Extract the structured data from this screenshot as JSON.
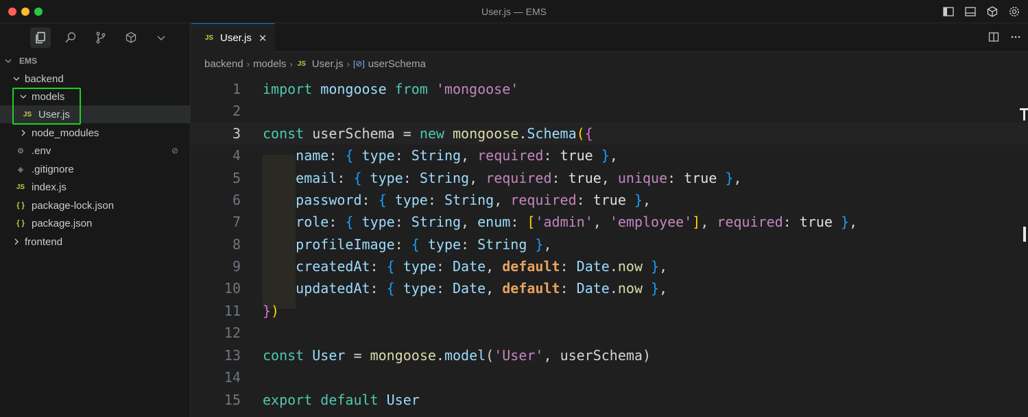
{
  "window": {
    "title": "User.js — EMS"
  },
  "sidebar": {
    "section_title": "EMS",
    "tree": [
      {
        "label": "backend",
        "kind": "folder",
        "open": true,
        "depth": 1
      },
      {
        "label": "models",
        "kind": "folder",
        "open": true,
        "depth": 2
      },
      {
        "label": "User.js",
        "kind": "js",
        "depth": 3,
        "selected": true
      },
      {
        "label": "node_modules",
        "kind": "folder",
        "open": false,
        "depth": 2
      },
      {
        "label": ".env",
        "kind": "env",
        "depth": 2,
        "badge": "⊘"
      },
      {
        "label": ".gitignore",
        "kind": "git",
        "depth": 2
      },
      {
        "label": "index.js",
        "kind": "js",
        "depth": 2
      },
      {
        "label": "package-lock.json",
        "kind": "json",
        "depth": 2
      },
      {
        "label": "package.json",
        "kind": "json",
        "depth": 2
      },
      {
        "label": "frontend",
        "kind": "folder",
        "open": false,
        "depth": 1
      }
    ],
    "js_icon_text": "JS",
    "json_icon_text": "{ }"
  },
  "editor": {
    "tab": {
      "icon_text": "JS",
      "label": "User.js",
      "close": "✕"
    },
    "breadcrumb": [
      "backend",
      "models",
      "User.js",
      "userSchema"
    ],
    "breadcrumb_js_icon": "JS",
    "current_line": 3,
    "line_numbers": [
      "1",
      "2",
      "3",
      "4",
      "5",
      "6",
      "7",
      "8",
      "9",
      "10",
      "11",
      "12",
      "13",
      "14",
      "15"
    ]
  },
  "code": {
    "line1": {
      "a": "import",
      "b": "mongoose",
      "c": "from",
      "d": "'mongoose'"
    },
    "line3": {
      "a": "const",
      "b": "userSchema",
      "c": "=",
      "d": "new",
      "e": "mongoose",
      "f": ".",
      "g": "Schema",
      "h": "(",
      "i": "{"
    },
    "line4": {
      "a": "name",
      "b": "type",
      "c": "String",
      "d": "required",
      "e": "true"
    },
    "line5": {
      "a": "email",
      "b": "type",
      "c": "String",
      "d": "required",
      "e": "true",
      "f": "unique",
      "g": "true"
    },
    "line6": {
      "a": "password",
      "b": "type",
      "c": "String",
      "d": "required",
      "e": "true"
    },
    "line7": {
      "a": "role",
      "b": "type",
      "c": "String",
      "d": "enum",
      "e": "'admin'",
      "f": "'employee'",
      "g": "required",
      "h": "true"
    },
    "line8": {
      "a": "profileImage",
      "b": "type",
      "c": "String"
    },
    "line9": {
      "a": "createdAt",
      "b": "type",
      "c": "Date",
      "d": "default",
      "e": "Date",
      "f": "now"
    },
    "line10": {
      "a": "updatedAt",
      "b": "type",
      "c": "Date",
      "d": "default",
      "e": "Date",
      "f": "now"
    },
    "line11": {
      "a": "}",
      "b": ")"
    },
    "line13": {
      "a": "const",
      "b": "User",
      "c": "=",
      "d": "mongoose",
      "e": "model",
      "f": "'User'",
      "g": "userSchema"
    },
    "line15": {
      "a": "export",
      "b": "default",
      "c": "User"
    }
  },
  "colors": {
    "accent": "#0078d4",
    "highlight_box": "#1fd11f"
  }
}
